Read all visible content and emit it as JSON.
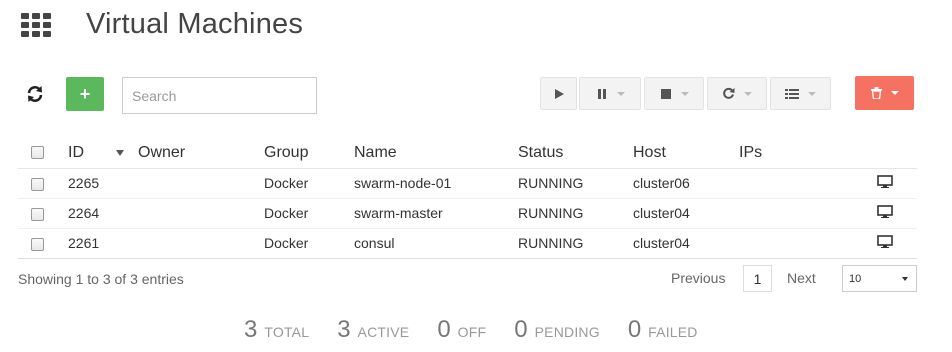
{
  "page": {
    "title": "Virtual Machines"
  },
  "search": {
    "placeholder": "Search",
    "value": ""
  },
  "toolbar": {
    "refresh_icon": "refresh-icon",
    "add_label": "+",
    "actions": [
      "play-icon",
      "pause-icon",
      "stop-icon",
      "reboot-icon",
      "list-icon"
    ],
    "delete_icon": "trash-icon",
    "colors": {
      "add": "#5cb85c",
      "delete": "#f57263"
    }
  },
  "table": {
    "columns": [
      "ID",
      "Owner",
      "Group",
      "Name",
      "Status",
      "Host",
      "IPs"
    ],
    "rows": [
      {
        "id": "2265",
        "owner": "",
        "group": "Docker",
        "name": "swarm-node-01",
        "status": "RUNNING",
        "host": "cluster06",
        "ips": ""
      },
      {
        "id": "2264",
        "owner": "",
        "group": "Docker",
        "name": "swarm-master",
        "status": "RUNNING",
        "host": "cluster04",
        "ips": ""
      },
      {
        "id": "2261",
        "owner": "",
        "group": "Docker",
        "name": "consul",
        "status": "RUNNING",
        "host": "cluster04",
        "ips": ""
      }
    ]
  },
  "pagination": {
    "info": "Showing 1 to 3 of 3 entries",
    "previous": "Previous",
    "current_page": "1",
    "next": "Next",
    "page_size": "10"
  },
  "stats": [
    {
      "value": "3",
      "label": "TOTAL"
    },
    {
      "value": "3",
      "label": "ACTIVE"
    },
    {
      "value": "0",
      "label": "OFF"
    },
    {
      "value": "0",
      "label": "PENDING"
    },
    {
      "value": "0",
      "label": "FAILED"
    }
  ]
}
